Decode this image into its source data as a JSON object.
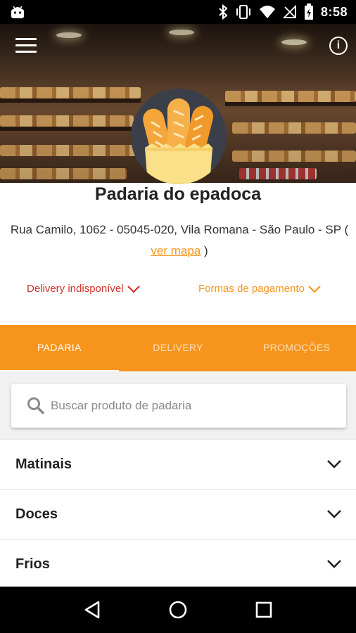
{
  "status_bar": {
    "time": "8:58",
    "icons": [
      "android-icon",
      "bluetooth-icon",
      "vibrate-icon",
      "wifi-icon",
      "no-signal-icon",
      "battery-icon"
    ]
  },
  "header": {
    "menu_icon": "hamburger-menu-icon",
    "info_icon": "info-icon",
    "info_symbol": "i",
    "logo": "bread-bag-logo"
  },
  "store": {
    "name": "Padaria do epadoca",
    "address_line": "Rua Camilo, 1062 - 05045-020, Vila Romana - São Paulo - SP ( ",
    "map_link": "ver mapa",
    "address_close": " )",
    "delivery_status": "Delivery indisponível",
    "payment_label": "Formas de pagamento"
  },
  "colors": {
    "accent": "#f7941d",
    "alert": "#d0312d"
  },
  "tabs": [
    {
      "label": "PADARIA",
      "active": true
    },
    {
      "label": "DELIVERY",
      "active": false
    },
    {
      "label": "PROMOÇÕES",
      "active": false
    }
  ],
  "search": {
    "placeholder": "Buscar produto de padaria"
  },
  "categories": [
    {
      "label": "Matinais"
    },
    {
      "label": "Doces"
    },
    {
      "label": "Frios"
    }
  ],
  "nav_bar": {
    "icons": [
      "back-icon",
      "home-icon",
      "recents-icon"
    ]
  }
}
